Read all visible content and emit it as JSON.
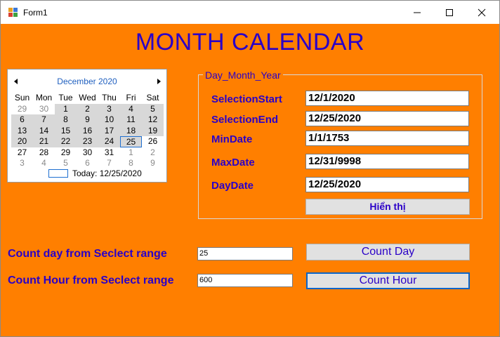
{
  "window": {
    "title": "Form1"
  },
  "heading": "MONTH CALENDAR",
  "calendar": {
    "month_title": "December 2020",
    "days_of_week": [
      "Sun",
      "Mon",
      "Tue",
      "Wed",
      "Thu",
      "Fri",
      "Sat"
    ],
    "weeks": [
      [
        "29",
        "30",
        "1",
        "2",
        "3",
        "4",
        "5"
      ],
      [
        "6",
        "7",
        "8",
        "9",
        "10",
        "11",
        "12"
      ],
      [
        "13",
        "14",
        "15",
        "16",
        "17",
        "18",
        "19"
      ],
      [
        "20",
        "21",
        "22",
        "23",
        "24",
        "25",
        "26"
      ],
      [
        "27",
        "28",
        "29",
        "30",
        "31",
        "1",
        "2"
      ],
      [
        "3",
        "4",
        "5",
        "6",
        "7",
        "8",
        "9"
      ]
    ],
    "today_label": "Today: 12/25/2020"
  },
  "group": {
    "legend": "Day_Month_Year",
    "fields": [
      {
        "label": "SelectionStart",
        "value": "12/1/2020"
      },
      {
        "label": "SelectionEnd",
        "value": "12/25/2020"
      },
      {
        "label": "MinDate",
        "value": "1/1/1753"
      },
      {
        "label": "MaxDate",
        "value": "12/31/9998"
      },
      {
        "label": "DayDate",
        "value": "12/25/2020"
      }
    ],
    "show_button": "Hiển thị"
  },
  "count_day": {
    "label": "Count day from Seclect range",
    "value": "25",
    "button": "Count Day"
  },
  "count_hour": {
    "label": "Count Hour from Seclect range",
    "value": "600",
    "button": "Count Hour"
  },
  "colors": {
    "form_background": "#ff7f00",
    "text_accent": "#2a00c8",
    "calendar_selection": "#d8d8d8"
  }
}
